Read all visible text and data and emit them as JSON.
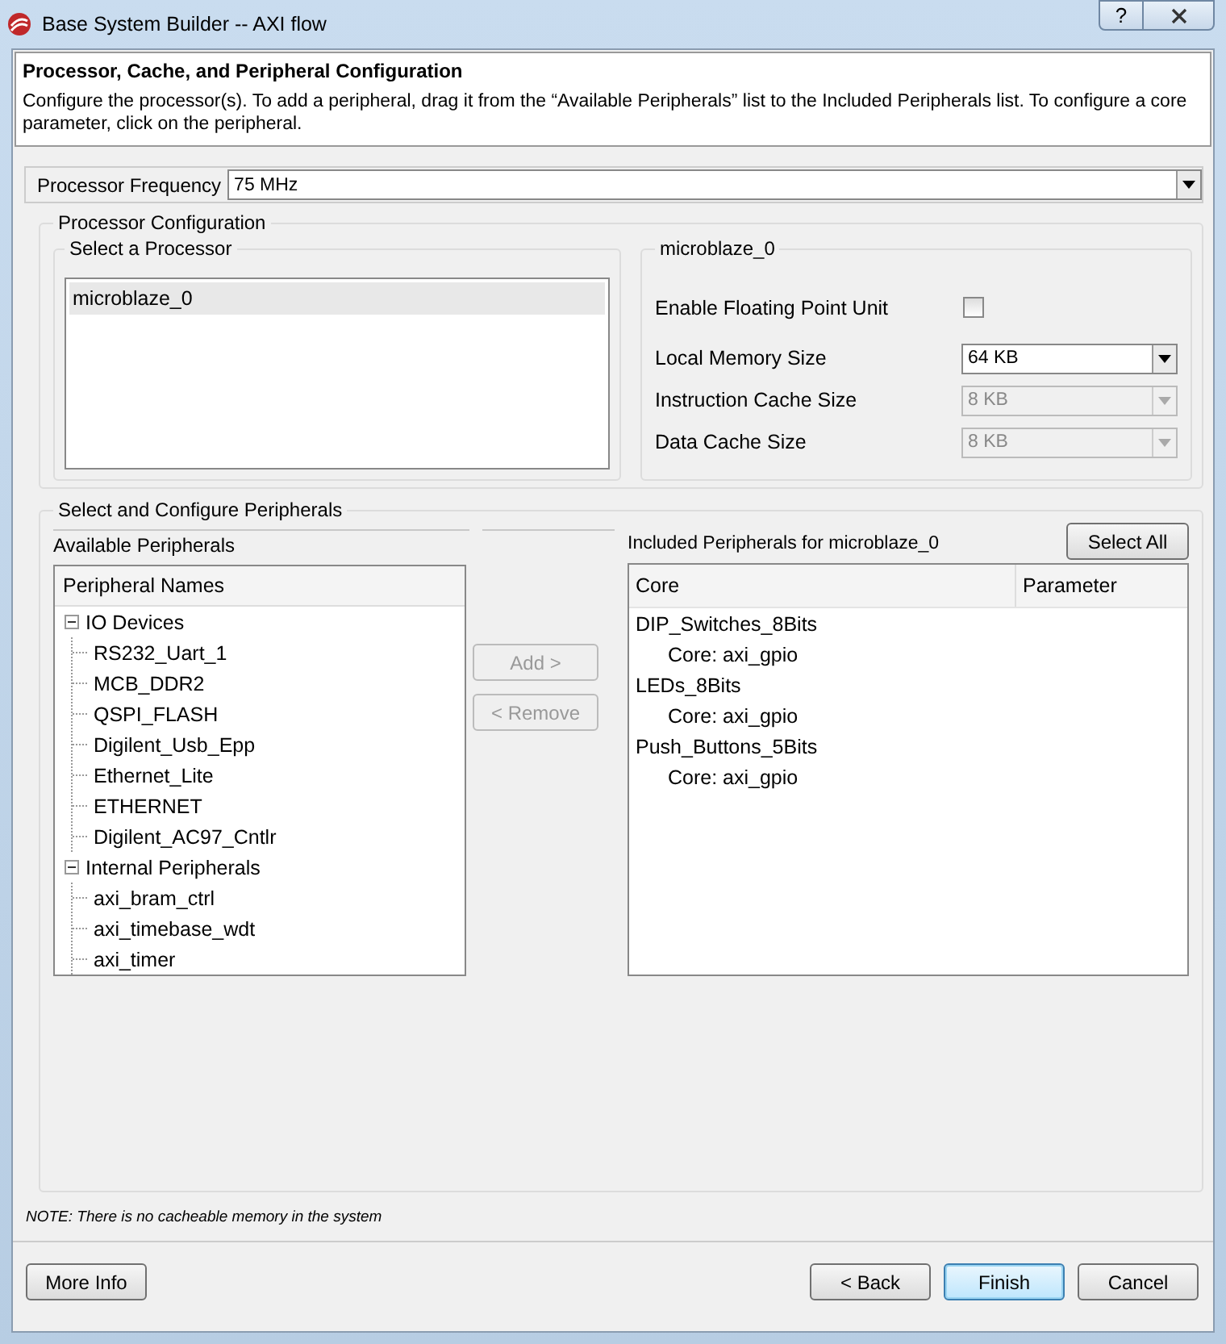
{
  "window": {
    "title": "Base System Builder -- AXI flow",
    "help_button": "?"
  },
  "header": {
    "title": "Processor, Cache, and Peripheral Configuration",
    "description": "Configure the processor(s). To add a peripheral, drag it from the “Available Peripherals” list to the Included Peripherals list. To configure a core parameter, click on the peripheral."
  },
  "processor_frequency": {
    "label": "Processor Frequency",
    "value": "75 MHz"
  },
  "processor_configuration": {
    "title": "Processor Configuration",
    "select_processor": {
      "title": "Select a Processor",
      "items": [
        {
          "label": "microblaze_0",
          "selected": true
        }
      ]
    },
    "settings": {
      "title": "microblaze_0",
      "fields": [
        {
          "kind": "checkbox",
          "label": "Enable Floating Point Unit",
          "checked": false
        },
        {
          "kind": "dropdown",
          "label": "Local Memory Size",
          "value": "64 KB",
          "disabled": false
        },
        {
          "kind": "dropdown",
          "label": "Instruction Cache Size",
          "value": "8 KB",
          "disabled": true
        },
        {
          "kind": "dropdown",
          "label": "Data Cache Size",
          "value": "8 KB",
          "disabled": true
        }
      ]
    }
  },
  "peripherals": {
    "title": "Select and Configure Peripherals",
    "available": {
      "title": "Available Peripherals",
      "column": "Peripheral Names",
      "tree": [
        {
          "label": "IO Devices",
          "expanded": true,
          "children": [
            {
              "label": "RS232_Uart_1"
            },
            {
              "label": "MCB_DDR2"
            },
            {
              "label": "QSPI_FLASH"
            },
            {
              "label": "Digilent_Usb_Epp"
            },
            {
              "label": "Ethernet_Lite"
            },
            {
              "label": "ETHERNET"
            },
            {
              "label": "Digilent_AC97_Cntlr"
            }
          ]
        },
        {
          "label": "Internal Peripherals",
          "expanded": true,
          "children": [
            {
              "label": "axi_bram_ctrl"
            },
            {
              "label": "axi_timebase_wdt"
            },
            {
              "label": "axi_timer"
            }
          ]
        }
      ]
    },
    "buttons": [
      {
        "label": "Add >",
        "disabled": true
      },
      {
        "label": "< Remove",
        "disabled": true
      }
    ],
    "included": {
      "title": "Included Peripherals for microblaze_0",
      "select_all": "Select All",
      "columns": [
        "Core",
        "Parameter"
      ],
      "rows": [
        {
          "name": "DIP_Switches_8Bits",
          "children": [
            {
              "name": "Core: axi_gpio"
            }
          ]
        },
        {
          "name": "LEDs_8Bits",
          "children": [
            {
              "name": "Core: axi_gpio"
            }
          ]
        },
        {
          "name": "Push_Buttons_5Bits",
          "children": [
            {
              "name": "Core: axi_gpio"
            }
          ]
        }
      ]
    }
  },
  "note": "NOTE: There is no cacheable memory in the system",
  "footer": {
    "left": [
      {
        "label": "More Info",
        "default": false
      }
    ],
    "right": [
      {
        "label": "< Back",
        "default": false
      },
      {
        "label": "Finish",
        "default": true
      },
      {
        "label": "Cancel",
        "default": false
      }
    ]
  }
}
